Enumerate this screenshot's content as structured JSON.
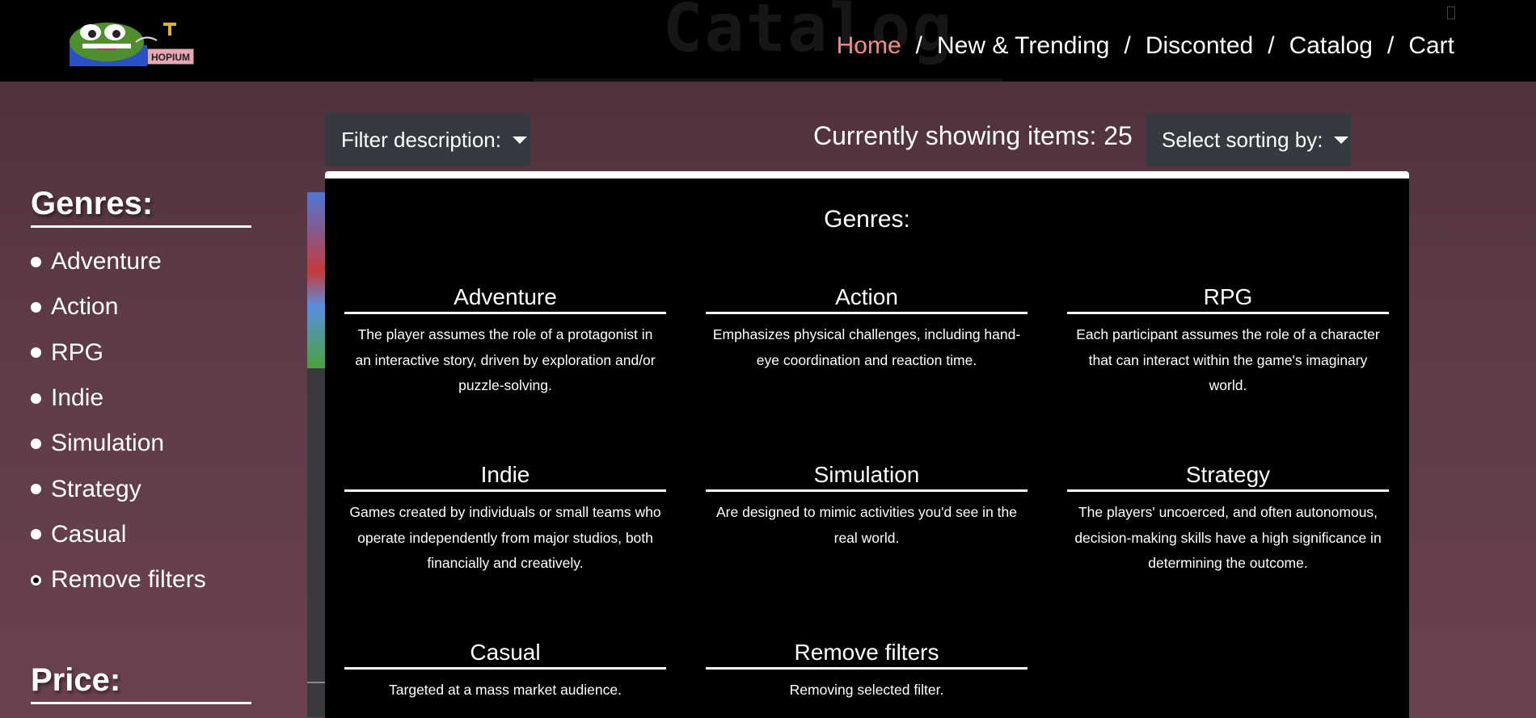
{
  "header": {
    "watermark": "Catalog",
    "logo_text": "HOPIUM",
    "nav": [
      {
        "label": "Home",
        "active": true
      },
      {
        "label": "New & Trending",
        "active": false
      },
      {
        "label": "Disconted",
        "active": false
      },
      {
        "label": "Catalog",
        "active": false
      },
      {
        "label": "Cart",
        "active": false
      }
    ],
    "separator": "/"
  },
  "toolbar": {
    "filter_label": "Filter description:",
    "showing_text": "Currently showing items: 25",
    "sort_label": "Select sorting by:"
  },
  "sidebar": {
    "genres_heading": "Genres:",
    "genres": [
      "Adventure",
      "Action",
      "RPG",
      "Indie",
      "Simulation",
      "Strategy",
      "Casual",
      "Remove filters"
    ],
    "price_heading": "Price:"
  },
  "dropdown": {
    "title": "Genres:",
    "cards": [
      {
        "name": "Adventure",
        "desc": "The player assumes the role of a protagonist in an interactive story, driven by exploration and/or puzzle-solving."
      },
      {
        "name": "Action",
        "desc": "Emphasizes physical challenges, including hand-eye coordination and reaction time."
      },
      {
        "name": "RPG",
        "desc": "Each participant assumes the role of a character that can interact within the game's imaginary world."
      },
      {
        "name": "Indie",
        "desc": "Games created by individuals or small teams who operate independently from major studios, both financially and creatively."
      },
      {
        "name": "Simulation",
        "desc": "Are designed to mimic activities you'd see in the real world."
      },
      {
        "name": "Strategy",
        "desc": "The players' uncoerced, and often autonomous, decision-making skills have a high significance in determining the outcome."
      },
      {
        "name": "Casual",
        "desc": "Targeted at a mass market audience."
      },
      {
        "name": "Remove filters",
        "desc": "Removing selected filter."
      }
    ]
  },
  "colors": {
    "nav_active": "#f08c8c",
    "button_bg": "#343a40",
    "panel_bg": "#000000"
  }
}
